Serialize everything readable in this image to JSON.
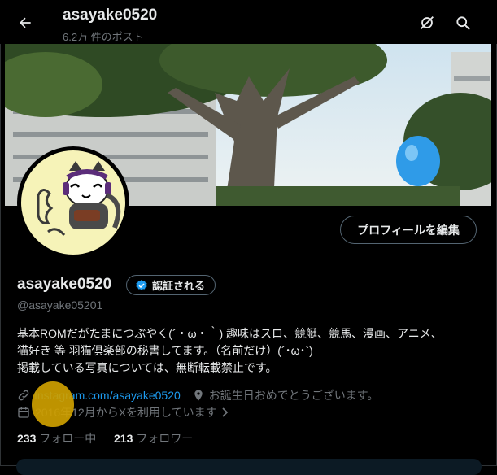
{
  "header": {
    "title": "asayake0520",
    "subtitle": "6.2万 件のポスト"
  },
  "profile": {
    "edit_label": "プロフィールを編集",
    "name": "asayake0520",
    "verified_label": "認証される",
    "handle": "@asayake05201",
    "bio_lines": [
      "基本ROMだがたまにつぶやく(´・ω・｀) 趣味はスロ、競艇、競馬、漫画、アニメ、",
      "猫好き 等 羽猫倶楽部の秘書してます。（名前だけ）(´･ω･`)",
      "掲載している写真については、無断転載禁止です。"
    ],
    "link": "Instagram.com/asayake0520",
    "location": "お誕生日おめでとうございます。",
    "joined": "2016年12月からXを利用しています",
    "following_count": "233",
    "following_label": "フォロー中",
    "followers_count": "213",
    "followers_label": "フォロワー"
  },
  "colors": {
    "background": "#000000",
    "text": "#e7e9ea",
    "muted": "#71767b",
    "link": "#1d9bf0",
    "verified": "#1d9bf0"
  }
}
